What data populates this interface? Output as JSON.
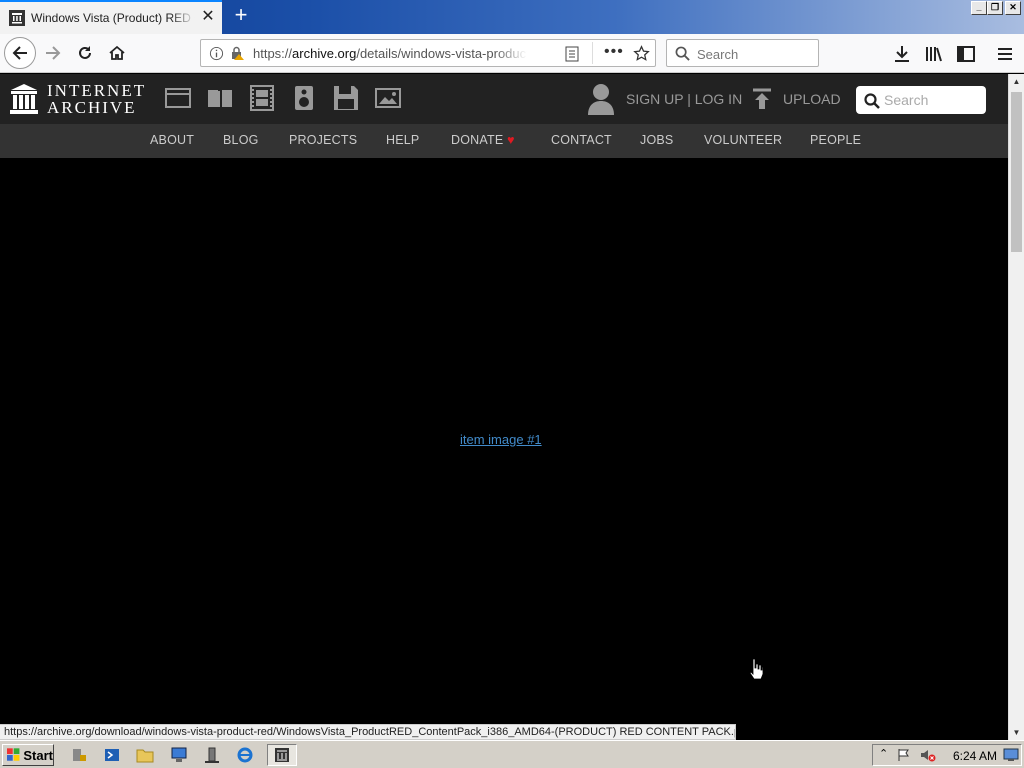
{
  "browser": {
    "tab_title": "Windows Vista (Product) RED Content Pack",
    "new_tab_symbol": "+",
    "close_symbol": "✕",
    "url_prefix": "https://",
    "url_host": "archive.org",
    "url_path": "/details/windows-vista-product-red",
    "search_placeholder": "Search"
  },
  "ia_header": {
    "logo_line1": "INTERNET",
    "logo_line2": "ARCHIVE",
    "signup_login": "SIGN UP | LOG IN",
    "upload": "UPLOAD",
    "search_placeholder": "Search",
    "nav": [
      "ABOUT",
      "BLOG",
      "PROJECTS",
      "HELP",
      "DONATE",
      "CONTACT",
      "JOBS",
      "VOLUNTEER",
      "PEOPLE"
    ],
    "donate_heart_color": "#e01a22"
  },
  "content": {
    "item_link": "item image #1"
  },
  "status_bar": {
    "text": "https://archive.org/download/windows-vista-product-red/WindowsVista_ProductRED_ContentPack_i386_AMD64-(PRODUCT) RED CONTENT PACK.png"
  },
  "taskbar": {
    "start_label": "Start",
    "clock": "6:24 AM"
  }
}
